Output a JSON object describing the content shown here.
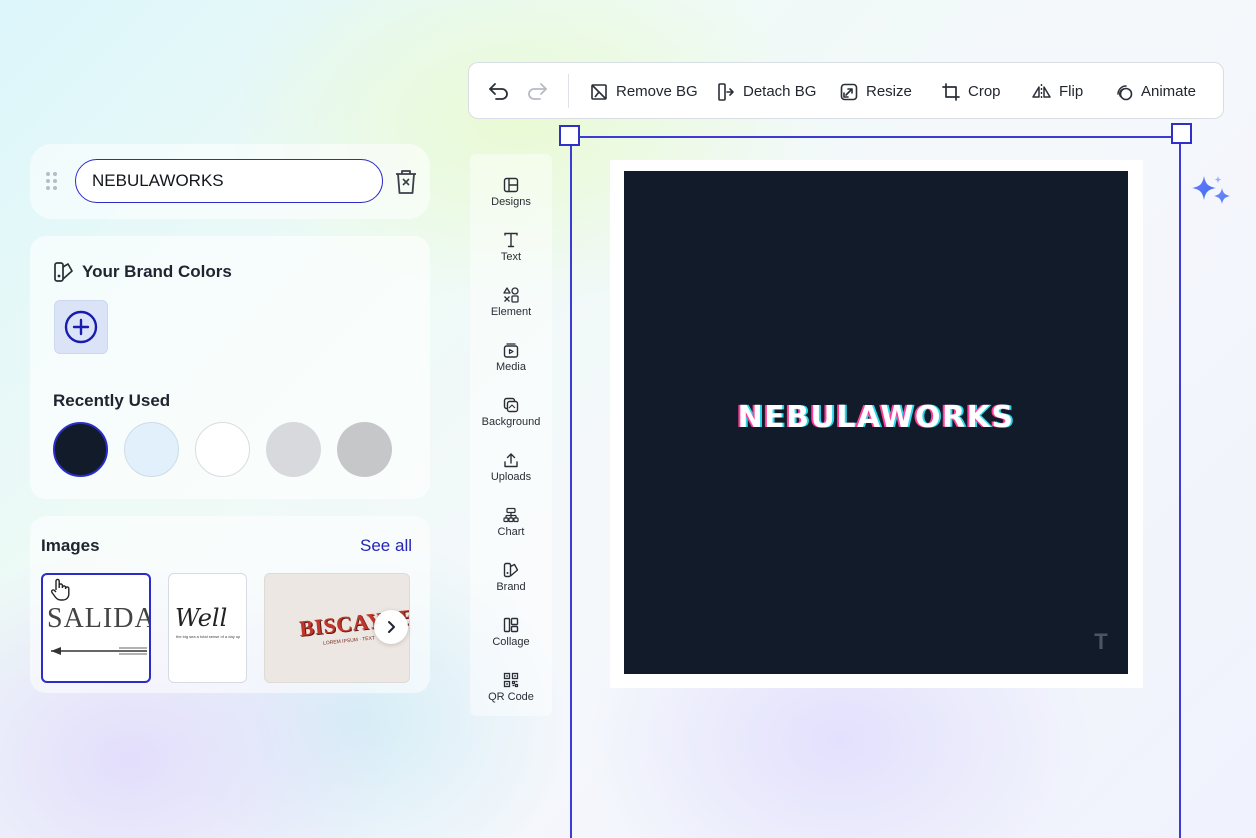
{
  "layer": {
    "text_value": "NEBULAWORKS"
  },
  "brand_colors": {
    "title": "Your Brand Colors",
    "recently_used_title": "Recently Used",
    "recent_swatches": [
      "#111b2a",
      "#e2f0fb",
      "#ffffff",
      "#d8d9dc",
      "#c6c7c9"
    ]
  },
  "images": {
    "title": "Images",
    "see_all": "See all",
    "thumbnails": [
      {
        "text": "SALIDA"
      },
      {
        "text": "Well",
        "subtext": "the big sea a total sense of a day up"
      },
      {
        "text": "BISCAYNE",
        "subtext": "LOREM IPSUM · TEXT"
      }
    ]
  },
  "toolbar": {
    "remove_bg": "Remove BG",
    "detach_bg": "Detach BG",
    "resize": "Resize",
    "crop": "Crop",
    "flip": "Flip",
    "animate": "Animate"
  },
  "rail": {
    "items": [
      {
        "label": "Designs"
      },
      {
        "label": "Text"
      },
      {
        "label": "Element"
      },
      {
        "label": "Media"
      },
      {
        "label": "Background"
      },
      {
        "label": "Uploads"
      },
      {
        "label": "Chart"
      },
      {
        "label": "Brand"
      },
      {
        "label": "Collage"
      },
      {
        "label": "QR Code"
      }
    ]
  },
  "canvas": {
    "headline": "NEBULAWORKS",
    "background_color": "#121b2a",
    "watermark": "T"
  },
  "colors": {
    "accent": "#2c2cc8",
    "selection": "#3b3bd6"
  }
}
